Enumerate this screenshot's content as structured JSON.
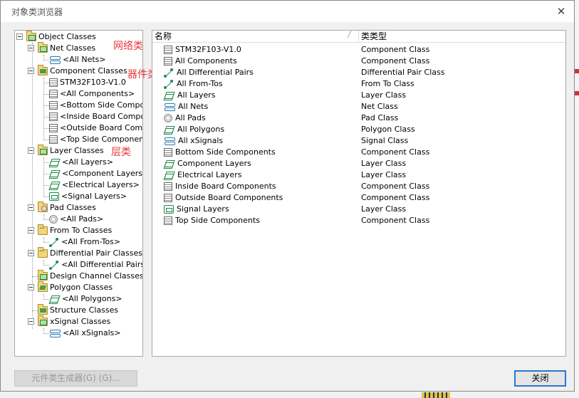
{
  "window": {
    "title": "对象类浏览器",
    "close_glyph": "✕"
  },
  "tree": {
    "object_classes": "Object Classes",
    "net_classes": "Net Classes",
    "all_nets": "<All Nets>",
    "component_classes": "Component Classes",
    "stm32": "STM32F103-V1.0",
    "all_components": "<All Components>",
    "bottom_side": "<Bottom Side Compor",
    "inside_board": "<Inside Board Compo",
    "outside_board": "<Outside Board Comp",
    "top_side": "<Top Side Componen",
    "layer_classes": "Layer Classes",
    "all_layers": "<All Layers>",
    "component_layers": "<Component Layers>",
    "electrical_layers": "<Electrical Layers>",
    "signal_layers": "<Signal Layers>",
    "pad_classes": "Pad Classes",
    "all_pads": "<All Pads>",
    "from_to_classes": "From To Classes",
    "all_from_tos": "<All From-Tos>",
    "diff_pair_classes": "Differential Pair Classes",
    "all_diff_pairs": "<All Differential Pairs>",
    "design_channel_classes": "Design Channel Classes",
    "polygon_classes": "Polygon Classes",
    "all_polygons": "<All Polygons>",
    "structure_classes": "Structure Classes",
    "xsignal_classes": "xSignal Classes",
    "all_xsignals": "<All xSignals>"
  },
  "annotations": {
    "net": "网络类",
    "component": "器件类",
    "layer": "层类"
  },
  "list": {
    "col_name": "名称",
    "col_type": "类类型",
    "rows": [
      {
        "name": "STM32F103-V1.0",
        "type": "Component Class",
        "icon": "comp"
      },
      {
        "name": "All Components",
        "type": "Component Class",
        "icon": "comp"
      },
      {
        "name": "All Differential Pairs",
        "type": "Differential Pair Class",
        "icon": "diff"
      },
      {
        "name": "All From-Tos",
        "type": "From To Class",
        "icon": "diff"
      },
      {
        "name": "All Layers",
        "type": "Layer Class",
        "icon": "layer"
      },
      {
        "name": "All Nets",
        "type": "Net Class",
        "icon": "nets"
      },
      {
        "name": "All Pads",
        "type": "Pad Class",
        "icon": "pad"
      },
      {
        "name": "All Polygons",
        "type": "Polygon Class",
        "icon": "layer"
      },
      {
        "name": "All xSignals",
        "type": "Signal Class",
        "icon": "nets"
      },
      {
        "name": "Bottom Side Components",
        "type": "Component Class",
        "icon": "comp"
      },
      {
        "name": "Component Layers",
        "type": "Layer Class",
        "icon": "layer"
      },
      {
        "name": "Electrical Layers",
        "type": "Layer Class",
        "icon": "layer"
      },
      {
        "name": "Inside Board Components",
        "type": "Component Class",
        "icon": "comp"
      },
      {
        "name": "Outside Board Components",
        "type": "Component Class",
        "icon": "comp"
      },
      {
        "name": "Signal Layers",
        "type": "Layer Class",
        "icon": "signal"
      },
      {
        "name": "Top Side Components",
        "type": "Component Class",
        "icon": "comp"
      }
    ]
  },
  "buttons": {
    "generator": "元件类生成器(G) (G)...",
    "close": "关闭"
  }
}
